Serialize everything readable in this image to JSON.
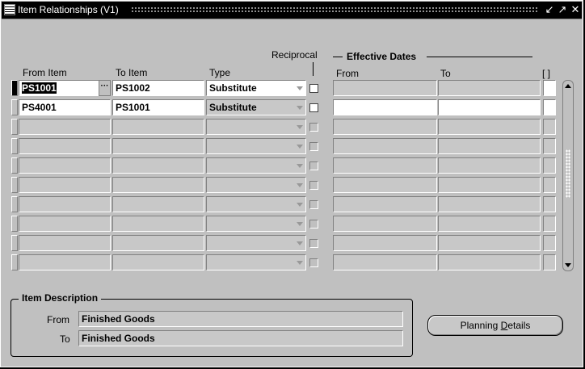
{
  "window": {
    "title": "Item Relationships (V1)"
  },
  "headers": {
    "from_item": "From Item",
    "to_item": "To Item",
    "type": "Type",
    "reciprocal": "Reciprocal",
    "effective_dates": "Effective Dates",
    "dates_from": "From",
    "dates_to": "To",
    "bracket": "[ ]"
  },
  "rows": [
    {
      "from_item": "PS1001",
      "to_item": "PS1002",
      "type": "Substitute",
      "reciprocal": false,
      "date_from": "",
      "date_to": ""
    },
    {
      "from_item": "PS4001",
      "to_item": "PS1001",
      "type": "Substitute",
      "reciprocal": false,
      "date_from": "",
      "date_to": ""
    },
    {
      "from_item": "",
      "to_item": "",
      "type": "",
      "reciprocal": false,
      "date_from": "",
      "date_to": ""
    },
    {
      "from_item": "",
      "to_item": "",
      "type": "",
      "reciprocal": false,
      "date_from": "",
      "date_to": ""
    },
    {
      "from_item": "",
      "to_item": "",
      "type": "",
      "reciprocal": false,
      "date_from": "",
      "date_to": ""
    },
    {
      "from_item": "",
      "to_item": "",
      "type": "",
      "reciprocal": false,
      "date_from": "",
      "date_to": ""
    },
    {
      "from_item": "",
      "to_item": "",
      "type": "",
      "reciprocal": false,
      "date_from": "",
      "date_to": ""
    },
    {
      "from_item": "",
      "to_item": "",
      "type": "",
      "reciprocal": false,
      "date_from": "",
      "date_to": ""
    },
    {
      "from_item": "",
      "to_item": "",
      "type": "",
      "reciprocal": false,
      "date_from": "",
      "date_to": ""
    },
    {
      "from_item": "",
      "to_item": "",
      "type": "",
      "reciprocal": false,
      "date_from": "",
      "date_to": ""
    }
  ],
  "item_description": {
    "title": "Item Description",
    "from_label": "From",
    "from_value": "Finished Goods",
    "to_label": "To",
    "to_value": "Finished Goods"
  },
  "buttons": {
    "planning_details_pre": "Planning ",
    "planning_details_mnemonic": "D",
    "planning_details_post": "etails"
  },
  "icons": {
    "app": "oracle-forms-icon",
    "minimize": "minimize-icon",
    "maximize": "maximize-icon",
    "close": "close-icon"
  }
}
